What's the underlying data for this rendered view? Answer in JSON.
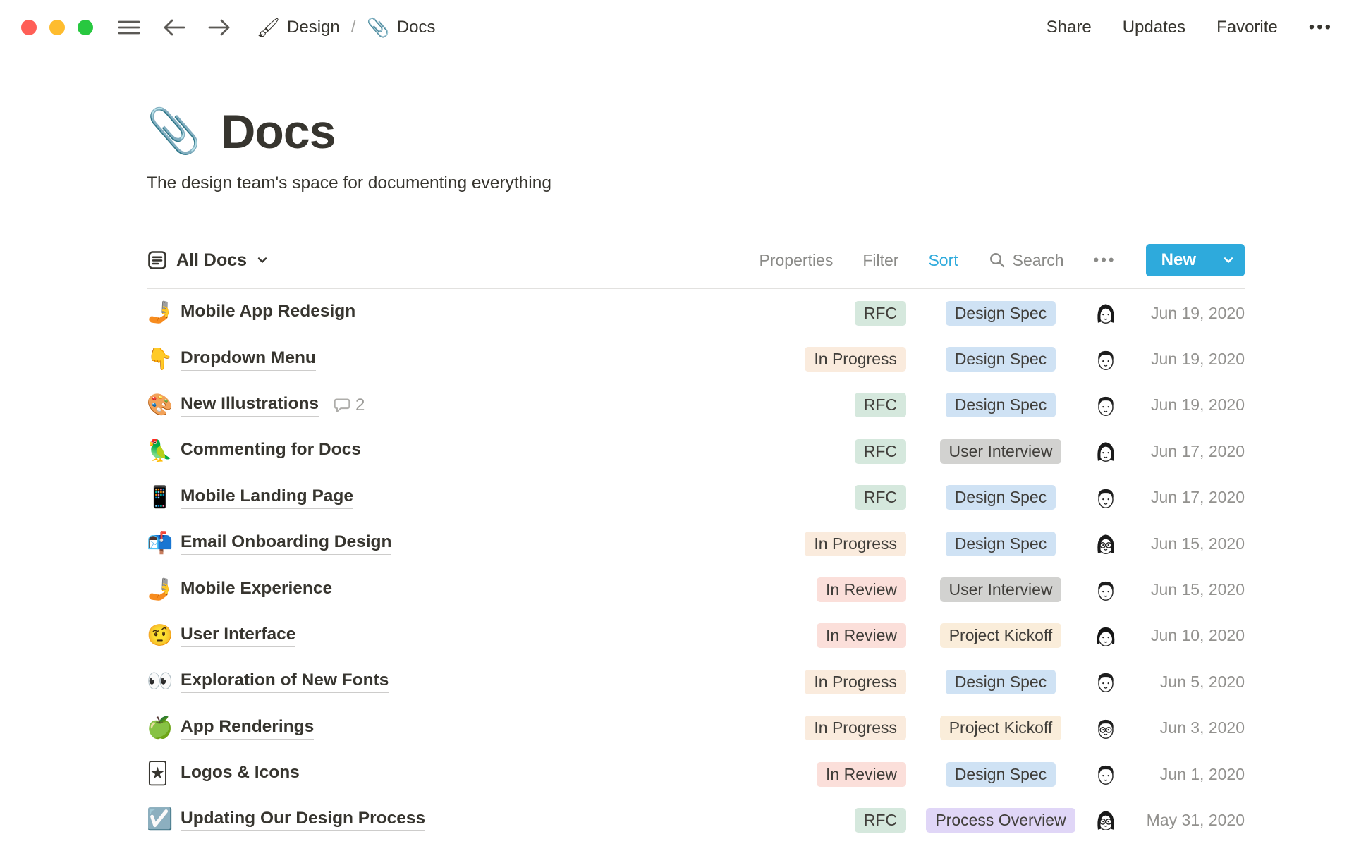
{
  "topbar": {
    "breadcrumb": [
      {
        "icon": "🖌",
        "label": "Design"
      },
      {
        "icon": "📎",
        "label": "Docs"
      }
    ],
    "separator": "/",
    "actions": [
      "Share",
      "Updates",
      "Favorite"
    ],
    "more_label": "•••"
  },
  "page": {
    "icon": "📎",
    "title": "Docs",
    "subtitle": "The design team's space for documenting everything"
  },
  "toolbar": {
    "view_label": "All Docs",
    "properties_label": "Properties",
    "filter_label": "Filter",
    "sort_label": "Sort",
    "search_label": "Search",
    "more_label": "•••",
    "new_label": "New"
  },
  "colors": {
    "accent_blue": "#2EAADC",
    "status": {
      "RFC": "#D5E8DD",
      "In Progress": "#FAEBDD",
      "In Review": "#FBDFDA"
    },
    "type": {
      "Design Spec": "#CFE2F4",
      "User Interview": "#D2D2D0",
      "Project Kickoff": "#FAEDDA",
      "Process Overview": "#E0D6F7"
    }
  },
  "rows": [
    {
      "emoji": "🤳",
      "title": "Mobile App Redesign",
      "comments": null,
      "status": "RFC",
      "type": "Design Spec",
      "avatar": "w1",
      "date": "Jun 19, 2020"
    },
    {
      "emoji": "👇",
      "title": "Dropdown Menu",
      "comments": null,
      "status": "In Progress",
      "type": "Design Spec",
      "avatar": "m1",
      "date": "Jun 19, 2020"
    },
    {
      "emoji": "🎨",
      "title": "New Illustrations",
      "comments": 2,
      "status": "RFC",
      "type": "Design Spec",
      "avatar": "m1",
      "date": "Jun 19, 2020"
    },
    {
      "emoji": "🦜",
      "title": "Commenting for Docs",
      "comments": null,
      "status": "RFC",
      "type": "User Interview",
      "avatar": "w1",
      "date": "Jun 17, 2020"
    },
    {
      "emoji": "📱",
      "title": "Mobile Landing Page",
      "comments": null,
      "status": "RFC",
      "type": "Design Spec",
      "avatar": "m1",
      "date": "Jun 17, 2020"
    },
    {
      "emoji": "📬",
      "title": "Email Onboarding Design",
      "comments": null,
      "status": "In Progress",
      "type": "Design Spec",
      "avatar": "g1",
      "date": "Jun 15, 2020"
    },
    {
      "emoji": "🤳",
      "title": "Mobile Experience",
      "comments": null,
      "status": "In Review",
      "type": "User Interview",
      "avatar": "m1",
      "date": "Jun 15, 2020"
    },
    {
      "emoji": "🤨",
      "title": "User Interface",
      "comments": null,
      "status": "In Review",
      "type": "Project Kickoff",
      "avatar": "w2",
      "date": "Jun 10, 2020"
    },
    {
      "emoji": "👀",
      "title": "Exploration of New Fonts",
      "comments": null,
      "status": "In Progress",
      "type": "Design Spec",
      "avatar": "m1",
      "date": "Jun 5, 2020"
    },
    {
      "emoji": "🍏",
      "title": "App Renderings",
      "comments": null,
      "status": "In Progress",
      "type": "Project Kickoff",
      "avatar": "g2",
      "date": "Jun 3, 2020"
    },
    {
      "emoji": "🃏",
      "title": "Logos & Icons",
      "comments": null,
      "status": "In Review",
      "type": "Design Spec",
      "avatar": "m1",
      "date": "Jun 1, 2020"
    },
    {
      "emoji": "☑️",
      "title": "Updating Our Design Process",
      "comments": null,
      "status": "RFC",
      "type": "Process Overview",
      "avatar": "g1",
      "date": "May 31, 2020"
    }
  ]
}
